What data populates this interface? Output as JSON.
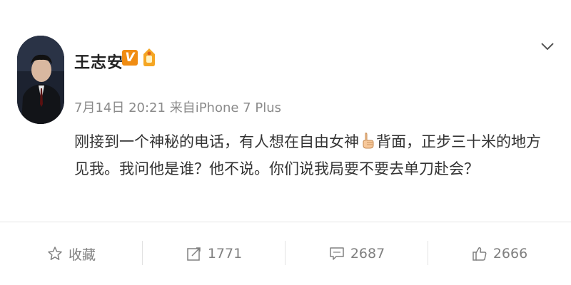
{
  "post": {
    "author": "王志安",
    "verified_badge": "V",
    "timestamp": "7月14日 20:21",
    "source_prefix": "来自",
    "source": "iPhone 7 Plus",
    "text_part1": "刚接到一个神秘的电话，有人想在自由女神",
    "text_part2": "背面，正步三十米的地方见我。我问他是谁？他不说。你们说我局要不要去单刀赴会？",
    "emoji": "finger-pointing-emoji"
  },
  "actions": {
    "favorite_label": "收藏",
    "repost_count": "1771",
    "comment_count": "2687",
    "like_count": "2666"
  },
  "icons": {
    "menu": "chevron-down-icon",
    "favorite": "star-icon",
    "repost": "repost-icon",
    "comment": "comment-icon",
    "like": "thumbs-up-icon"
  },
  "colors": {
    "verified": "#f08c12",
    "meta_text": "#8a8a8a",
    "action_text": "#808080"
  }
}
